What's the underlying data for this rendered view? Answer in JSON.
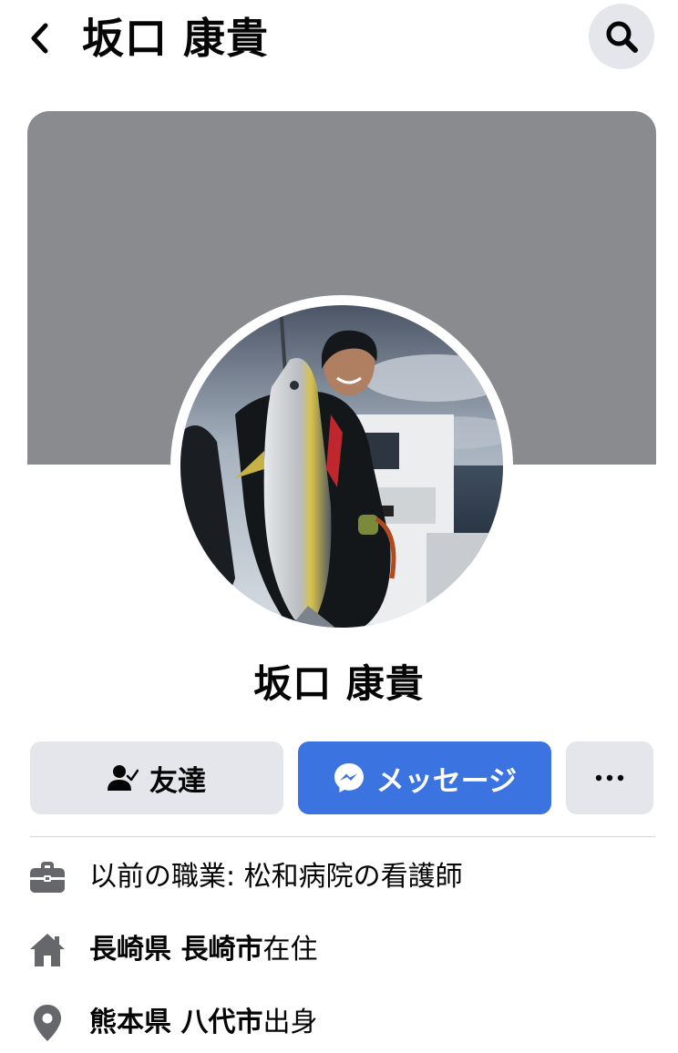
{
  "header": {
    "title": "坂口 康貴",
    "back_icon": "chevron-left-icon",
    "search_icon": "search-icon"
  },
  "profile": {
    "name": "坂口 康貴",
    "cover_color": "#8a8b8f"
  },
  "actions": {
    "friends_label": "友達",
    "friends_icon": "friend-check-icon",
    "message_label": "メッセージ",
    "message_icon": "messenger-icon",
    "message_color": "#3b73e1",
    "more_icon": "more-dots-icon"
  },
  "intro": {
    "work": {
      "text": "以前の職業: 松和病院の看護師",
      "icon": "briefcase-icon"
    },
    "lives_in": {
      "prefecture": "長崎県",
      "city": "長崎市",
      "suffix": "在住",
      "icon": "home-icon"
    },
    "from": {
      "prefecture": "熊本県",
      "city": "八代市",
      "suffix": "出身",
      "icon": "location-pin-icon"
    }
  }
}
